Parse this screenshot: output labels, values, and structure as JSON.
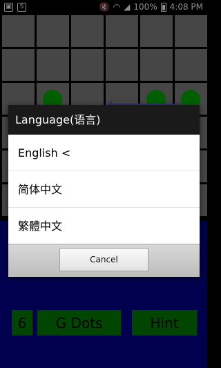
{
  "status_bar": {
    "battery": "100%",
    "time": "4:08 PM"
  },
  "game": {
    "count": "6",
    "mode_button": "G Dots",
    "hint_button": "Hint"
  },
  "dialog": {
    "title": "Language(语言)",
    "options": [
      {
        "label": "English <"
      },
      {
        "label": "简体中文"
      },
      {
        "label": "繁體中文"
      }
    ],
    "cancel_label": "Cancel"
  },
  "colors": {
    "board_cell": "#808080",
    "dot": "#00b000",
    "arrow": "#5560d0",
    "bottom_bg": "#000090",
    "button_green": "#008000"
  }
}
